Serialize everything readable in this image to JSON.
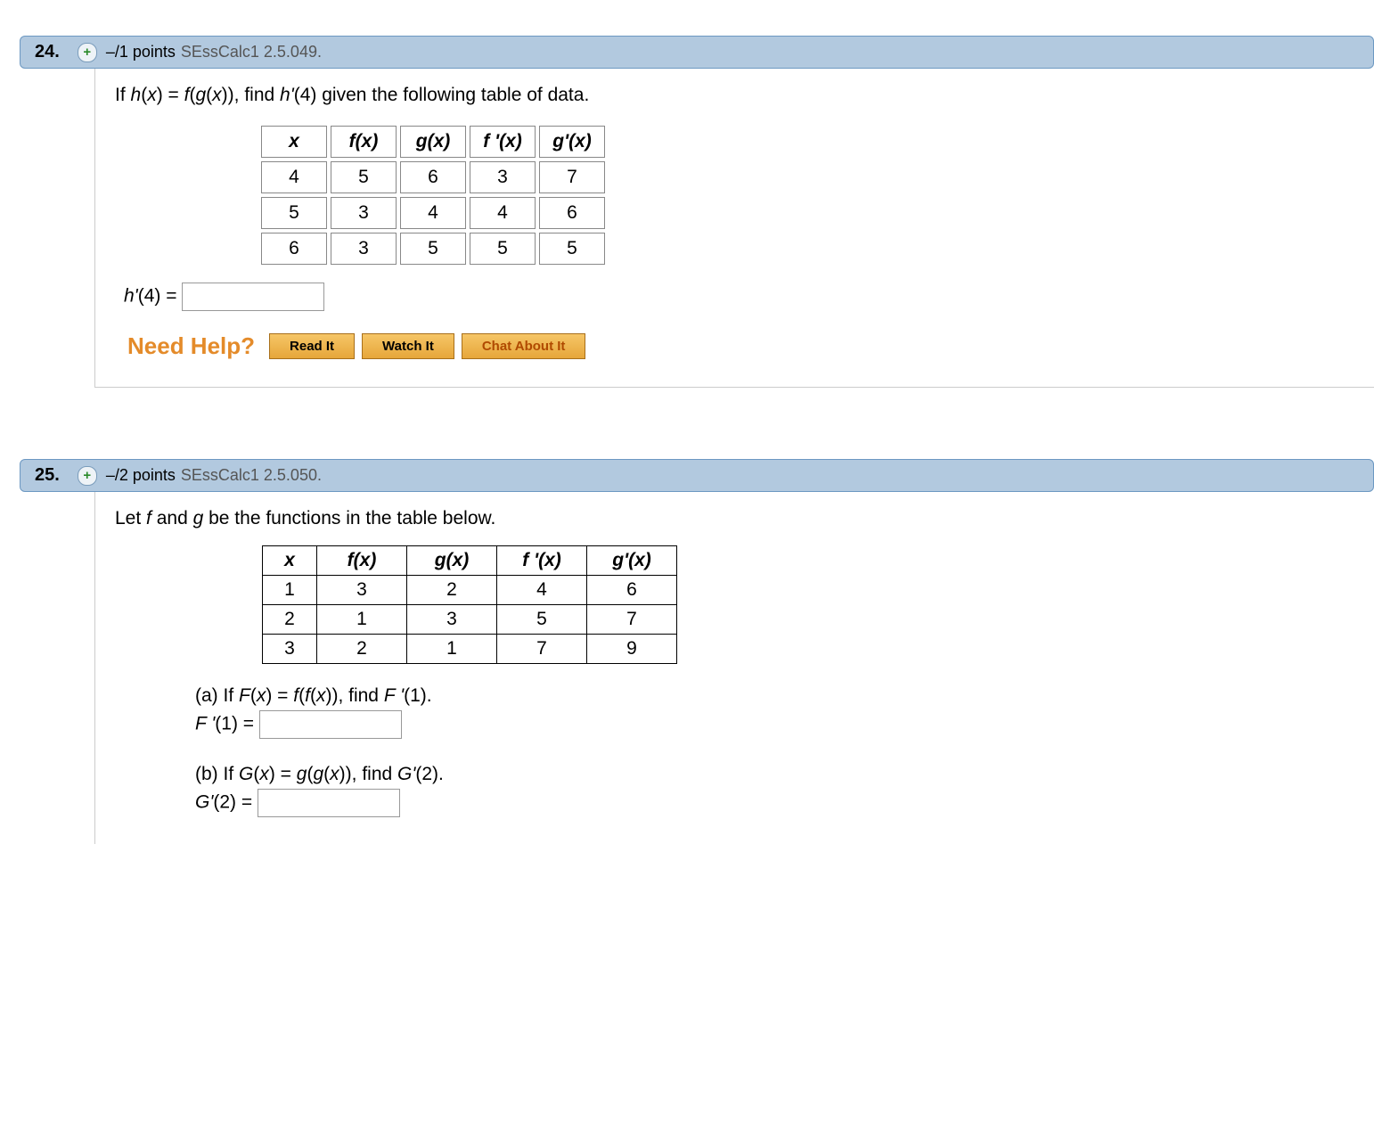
{
  "q24": {
    "number": "24.",
    "points": "–/1 points",
    "ref": "SEssCalc1 2.5.049.",
    "prompt_pre": "If ",
    "prompt_hx": "h",
    "prompt_paren1": "(",
    "prompt_x1": "x",
    "prompt_close1": ") = ",
    "prompt_f": "f",
    "prompt_open2": "(",
    "prompt_g": "g",
    "prompt_open3": "(",
    "prompt_x2": "x",
    "prompt_close3": ")), find ",
    "prompt_hprime": "h'",
    "prompt_arg": "(4)",
    "prompt_tail": " given the following table of data.",
    "headers": [
      "x",
      "f(x)",
      "g(x)",
      "f '(x)",
      "g'(x)"
    ],
    "rows": [
      [
        "4",
        "5",
        "6",
        "3",
        "7"
      ],
      [
        "5",
        "3",
        "4",
        "4",
        "6"
      ],
      [
        "6",
        "3",
        "5",
        "5",
        "5"
      ]
    ],
    "answer_lhs": "h'",
    "answer_arg": "(4) = ",
    "need_help": "Need Help?",
    "buttons": {
      "read": "Read It",
      "watch": "Watch It",
      "chat": "Chat About It"
    }
  },
  "q25": {
    "number": "25.",
    "points": "–/2 points",
    "ref": "SEssCalc1 2.5.050.",
    "prompt_pre": "Let ",
    "prompt_f": "f",
    "prompt_mid": " and ",
    "prompt_g": "g",
    "prompt_tail": " be the functions in the table below.",
    "headers": [
      "x",
      "f(x)",
      "g(x)",
      "f '(x)",
      "g'(x)"
    ],
    "rows": [
      [
        "1",
        "3",
        "2",
        "4",
        "6"
      ],
      [
        "2",
        "1",
        "3",
        "5",
        "7"
      ],
      [
        "3",
        "2",
        "1",
        "7",
        "9"
      ]
    ],
    "partA": {
      "label": "(a) If ",
      "F": "F",
      "open": "(",
      "x": "x",
      "close": ") = ",
      "rhs_f1": "f",
      "rhs_open1": "(",
      "rhs_f2": "f",
      "rhs_open2": "(",
      "rhs_x": "x",
      "rhs_close": ")), find ",
      "find_lhs": "F '",
      "find_arg": "(1).",
      "ans_lhs": "F '",
      "ans_eq": "(1) = "
    },
    "partB": {
      "label": "(b) If ",
      "G": "G",
      "open": "(",
      "x": "x",
      "close": ") = ",
      "rhs_g1": "g",
      "rhs_open1": "(",
      "rhs_g2": "g",
      "rhs_open2": "(",
      "rhs_x": "x",
      "rhs_close": ")), find ",
      "find_lhs": "G'",
      "find_arg": "(2).",
      "ans_lhs": "G'",
      "ans_eq": "(2) = "
    }
  }
}
